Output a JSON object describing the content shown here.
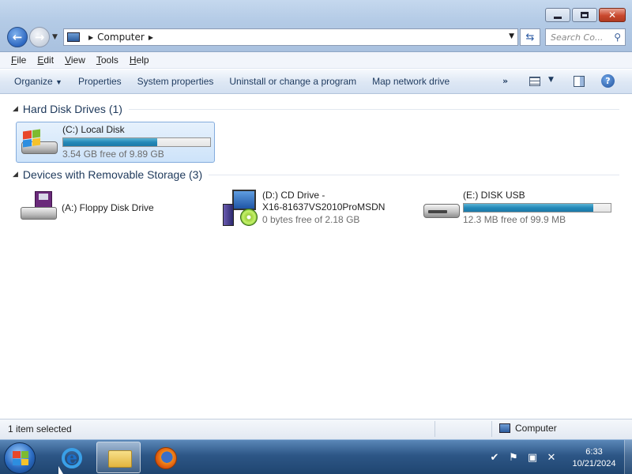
{
  "window": {
    "address_segments": [
      "Computer"
    ],
    "search_placeholder": "Search Co..."
  },
  "menubar": {
    "items": [
      {
        "label": "File",
        "accel": "F",
        "rest": "ile"
      },
      {
        "label": "Edit",
        "accel": "E",
        "rest": "dit"
      },
      {
        "label": "View",
        "accel": "V",
        "rest": "iew"
      },
      {
        "label": "Tools",
        "accel": "T",
        "rest": "ools"
      },
      {
        "label": "Help",
        "accel": "H",
        "rest": "elp"
      }
    ]
  },
  "commandbar": {
    "organize": "Organize",
    "properties": "Properties",
    "system_properties": "System properties",
    "uninstall": "Uninstall or change a program",
    "map_drive": "Map network drive",
    "more": "»"
  },
  "groups": {
    "hard_disks": {
      "title": "Hard Disk Drives (1)",
      "drives": [
        {
          "label": "(C:) Local Disk",
          "free_text": "3.54 GB free of 9.89 GB",
          "used_fraction": 0.64
        }
      ]
    },
    "removable": {
      "title": "Devices with Removable Storage (3)",
      "floppy": {
        "label": "(A:) Floppy Disk Drive"
      },
      "cd": {
        "label_line1": "(D:) CD Drive -",
        "label_line2": "X16-81637VS2010ProMSDN",
        "free_text": "0 bytes free of 2.18 GB"
      },
      "usb": {
        "label": "(E:) DISK USB",
        "free_text": "12.3 MB free of 99.9 MB",
        "used_fraction": 0.88
      }
    }
  },
  "statusbar": {
    "selection": "1 item selected",
    "location": "Computer"
  },
  "taskbar": {
    "time": "6:33",
    "date": "10/21/2024"
  },
  "colors": {
    "accent": "#2489b8",
    "selection_bg": "#cde3fa",
    "group_title": "#1e395b"
  }
}
